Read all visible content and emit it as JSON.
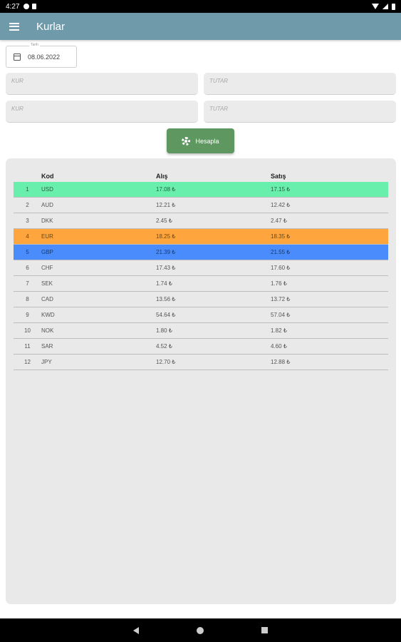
{
  "status_bar": {
    "time": "4:27"
  },
  "app_bar": {
    "title": "Kurlar"
  },
  "date_field": {
    "label": "Tarih",
    "value": "08.06.2022"
  },
  "inputs": {
    "kur1_placeholder": "KUR",
    "tutar1_placeholder": "TUTAR",
    "kur2_placeholder": "KUR",
    "tutar2_placeholder": "TUTAR"
  },
  "calc_button": {
    "label": "Hesapla"
  },
  "table": {
    "headers": {
      "no": "",
      "code": "Kod",
      "buy": "Alış",
      "sell": "Satış"
    },
    "rows": [
      {
        "no": "1",
        "code": "USD",
        "buy": "17.08 ₺",
        "sell": "17.15 ₺",
        "highlight": "#69efac"
      },
      {
        "no": "2",
        "code": "AUD",
        "buy": "12.21 ₺",
        "sell": "12.42 ₺"
      },
      {
        "no": "3",
        "code": "DKK",
        "buy": "2.45 ₺",
        "sell": "2.47 ₺"
      },
      {
        "no": "4",
        "code": "EUR",
        "buy": "18.25 ₺",
        "sell": "18.35 ₺",
        "highlight": "#fea63d"
      },
      {
        "no": "5",
        "code": "GBP",
        "buy": "21.39 ₺",
        "sell": "21.55 ₺",
        "highlight": "#4a8cfb"
      },
      {
        "no": "6",
        "code": "CHF",
        "buy": "17.43 ₺",
        "sell": "17.60 ₺"
      },
      {
        "no": "7",
        "code": "SEK",
        "buy": "1.74 ₺",
        "sell": "1.76 ₺"
      },
      {
        "no": "8",
        "code": "CAD",
        "buy": "13.56 ₺",
        "sell": "13.72 ₺"
      },
      {
        "no": "9",
        "code": "KWD",
        "buy": "54.64 ₺",
        "sell": "57.04 ₺"
      },
      {
        "no": "10",
        "code": "NOK",
        "buy": "1.80 ₺",
        "sell": "1.82 ₺"
      },
      {
        "no": "11",
        "code": "SAR",
        "buy": "4.52 ₺",
        "sell": "4.60 ₺"
      },
      {
        "no": "12",
        "code": "JPY",
        "buy": "12.70 ₺",
        "sell": "12.88 ₺"
      }
    ]
  },
  "icons": {
    "menu": "menu-icon",
    "calendar": "calendar-icon",
    "gear": "gear-icon",
    "nav_back": "back-triangle-icon",
    "nav_home": "home-circle-icon",
    "nav_recent": "recent-square-icon"
  },
  "colors": {
    "app_bar": "#6f9aa9",
    "button": "#5e9760",
    "usd_row": "#69efac",
    "eur_row": "#fea63d",
    "gbp_row": "#4a8cfb"
  }
}
